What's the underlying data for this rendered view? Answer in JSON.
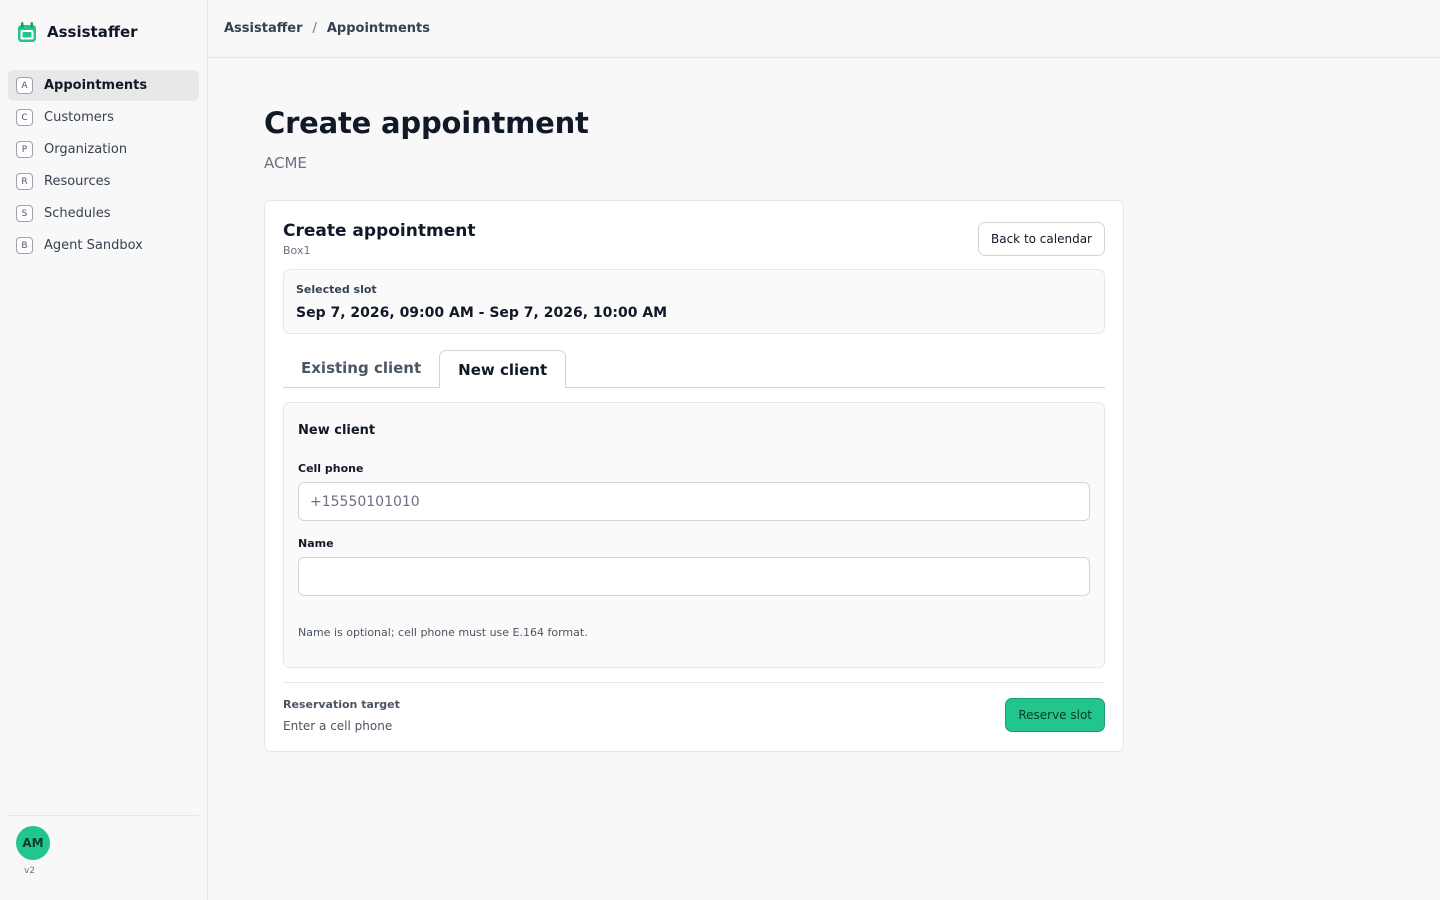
{
  "app": {
    "name": "Assistaffer",
    "logo_icon": "calendar-logo-icon",
    "accent_color": "#22c58b"
  },
  "sidebar": {
    "items": [
      {
        "letter": "A",
        "label": "Appointments",
        "active": true
      },
      {
        "letter": "C",
        "label": "Customers",
        "active": false
      },
      {
        "letter": "P",
        "label": "Organization",
        "active": false
      },
      {
        "letter": "R",
        "label": "Resources",
        "active": false
      },
      {
        "letter": "S",
        "label": "Schedules",
        "active": false
      },
      {
        "letter": "B",
        "label": "Agent Sandbox",
        "active": false
      }
    ],
    "user_initials": "AM",
    "version": "v2"
  },
  "breadcrumb": {
    "root": "Assistaffer",
    "separator": "/",
    "current": "Appointments"
  },
  "page": {
    "title": "Create appointment",
    "subtitle": "ACME"
  },
  "card": {
    "title": "Create appointment",
    "subtitle": "Box1",
    "back_button": "Back to calendar",
    "slot": {
      "label": "Selected slot",
      "value": "Sep 7, 2026, 09:00 AM - Sep 7, 2026, 10:00 AM"
    },
    "tabs": [
      {
        "label": "Existing client",
        "active": false
      },
      {
        "label": "New client",
        "active": true
      }
    ],
    "form": {
      "title": "New client",
      "phone_label": "Cell phone",
      "phone_placeholder": "+15550101010",
      "phone_value": "",
      "name_label": "Name",
      "name_placeholder": "",
      "name_value": "",
      "hint": "Name is optional; cell phone must use E.164 format."
    },
    "footer": {
      "target_label": "Reservation target",
      "target_value": "Enter a cell phone",
      "reserve_button": "Reserve slot"
    }
  }
}
